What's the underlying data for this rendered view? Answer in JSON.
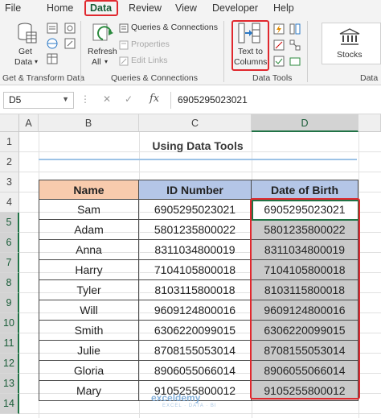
{
  "ribbon_tabs": [
    "File",
    "Home",
    "Data",
    "Review",
    "View",
    "Developer",
    "Help"
  ],
  "active_tab": "Data",
  "ribbon": {
    "get_data_line1": "Get",
    "get_data_line2": "Data",
    "refresh_line1": "Refresh",
    "refresh_line2": "All",
    "queries_connections": "Queries & Connections",
    "properties": "Properties",
    "edit_links": "Edit Links",
    "text_to_columns_line1": "Text to",
    "text_to_columns_line2": "Columns",
    "stocks": "Stocks",
    "group_get_transform": "Get & Transform Data",
    "group_queries": "Queries & Connections",
    "group_data_tools": "Data Tools",
    "group_data_types": "Data"
  },
  "formula_bar": {
    "name_box": "D5",
    "cancel": "✕",
    "enter": "✓",
    "fx": "fx",
    "content": "6905295023021"
  },
  "columns": [
    "A",
    "B",
    "C",
    "D"
  ],
  "rows": [
    "1",
    "2",
    "3",
    "4",
    "5",
    "6",
    "7",
    "8",
    "9",
    "10",
    "11",
    "12",
    "13",
    "14"
  ],
  "sheet": {
    "title": "Using Data Tools",
    "headers": [
      "Name",
      "ID Number",
      "Date of Birth"
    ],
    "records": [
      {
        "name": "Sam",
        "id": "6905295023021",
        "dob": "6905295023021"
      },
      {
        "name": "Adam",
        "id": "5801235800022",
        "dob": "5801235800022"
      },
      {
        "name": "Anna",
        "id": "8311034800019",
        "dob": "8311034800019"
      },
      {
        "name": "Harry",
        "id": "7104105800018",
        "dob": "7104105800018"
      },
      {
        "name": "Tyler",
        "id": "8103115800018",
        "dob": "8103115800018"
      },
      {
        "name": "Will",
        "id": "9609124800016",
        "dob": "9609124800016"
      },
      {
        "name": "Smith",
        "id": "6306220099015",
        "dob": "6306220099015"
      },
      {
        "name": "Julie",
        "id": "8708155053014",
        "dob": "8708155053014"
      },
      {
        "name": "Gloria",
        "id": "8906055066014",
        "dob": "8906055066014"
      },
      {
        "name": "Mary",
        "id": "9105255800012",
        "dob": "9105255800012"
      }
    ]
  },
  "watermark": {
    "brand": "exceldemy",
    "tagline": "EXCEL · DATA · BI"
  },
  "colors": {
    "excel_green": "#217346",
    "highlight_red": "#e0282e",
    "name_header": "#f8cbad",
    "id_header": "#b4c6e7",
    "selection_gray": "#c9c9c9"
  }
}
